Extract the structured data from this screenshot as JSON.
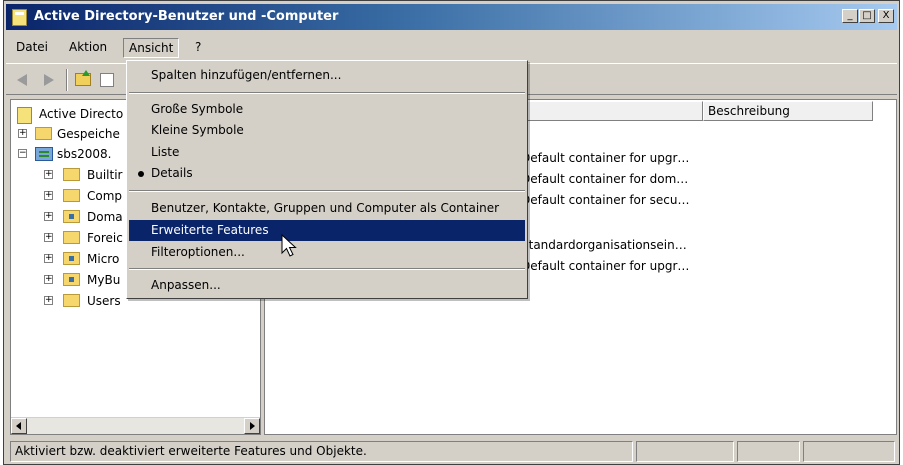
{
  "window": {
    "title": "Active Directory-Benutzer und -Computer",
    "controls": {
      "minimize": "_",
      "maximize": "□",
      "close": "X"
    }
  },
  "menubar": {
    "items": [
      "Datei",
      "Aktion",
      "Ansicht",
      "?"
    ],
    "open_menu": "Ansicht"
  },
  "tree": {
    "items": [
      {
        "label": "Active Directo",
        "icon": "ad-console-icon"
      },
      {
        "label": "Gespeiche",
        "icon": "folder-icon",
        "expander": "+"
      },
      {
        "label": "sbs2008.",
        "icon": "domain-icon",
        "expander": "−"
      },
      {
        "label": "Builtir",
        "icon": "folder-icon",
        "expander": "+"
      },
      {
        "label": "Comp",
        "icon": "folder-icon",
        "expander": "+"
      },
      {
        "label": "Doma",
        "icon": "ou-folder-icon",
        "expander": "+"
      },
      {
        "label": "Foreic",
        "icon": "folder-icon",
        "expander": "+"
      },
      {
        "label": "Micro",
        "icon": "ou-folder-icon",
        "expander": "+"
      },
      {
        "label": "MyBu",
        "icon": "ou-folder-icon",
        "expander": "+"
      },
      {
        "label": "Users",
        "icon": "folder-icon",
        "expander": "+"
      }
    ]
  },
  "list": {
    "columns": [
      "Beschreibung"
    ],
    "rows": [
      "Default container for upgr…",
      "Default container for dom…",
      "Default container for secu…",
      "",
      "Standardorganisationsein…",
      "Default container for upgr…"
    ]
  },
  "dropdown": {
    "items": [
      {
        "label": "Spalten hinzufügen/entfernen...",
        "type": "item"
      },
      {
        "type": "separator"
      },
      {
        "label": "Große Symbole",
        "type": "item"
      },
      {
        "label": "Kleine Symbole",
        "type": "item"
      },
      {
        "label": "Liste",
        "type": "item"
      },
      {
        "label": "Details",
        "type": "item",
        "checked": true
      },
      {
        "type": "separator"
      },
      {
        "label": "Benutzer, Kontakte, Gruppen und Computer als Container",
        "type": "item"
      },
      {
        "label": "Erweiterte Features",
        "type": "item",
        "highlighted": true
      },
      {
        "label": "Filteroptionen...",
        "type": "item"
      },
      {
        "type": "separator"
      },
      {
        "label": "Anpassen...",
        "type": "item"
      }
    ]
  },
  "statusbar": {
    "text": "Aktiviert bzw. deaktiviert erweiterte Features und Objekte."
  },
  "colors": {
    "title_gradient_start": "#0a246a",
    "title_gradient_end": "#a6caf0",
    "highlight": "#0a246a",
    "chrome": "#d4d0c8"
  }
}
